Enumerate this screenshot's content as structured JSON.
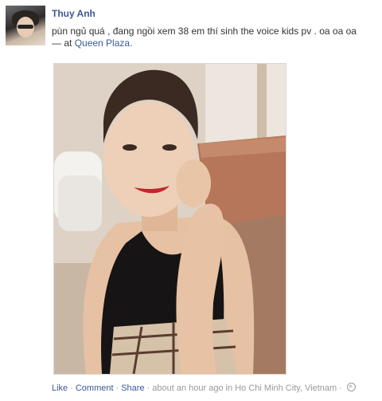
{
  "post": {
    "author": "Thuy Anh",
    "status_text": "pùn ngủ quá , đang ngồi xem 38 em thí sinh the voice kids pv . oa oa oa",
    "at_prefix": "— at",
    "place": "Queen Plaza."
  },
  "actions": {
    "like": "Like",
    "comment": "Comment",
    "share": "Share",
    "sep": "·",
    "timestamp": "about an hour ago in Ho Chi Minh City, Vietnam",
    "privacy_icon": "globe-icon"
  },
  "colors": {
    "link": "#3b5998",
    "meta": "#999999",
    "text": "#333333"
  }
}
